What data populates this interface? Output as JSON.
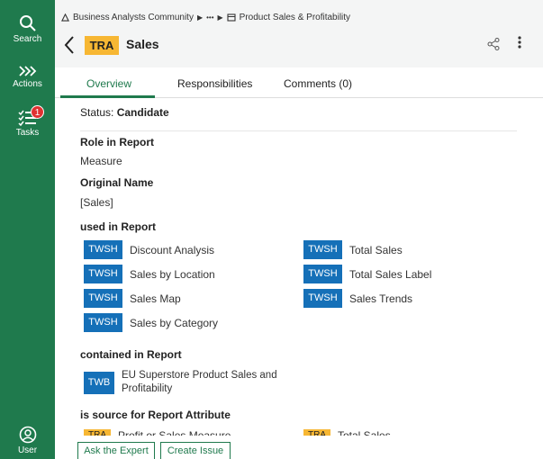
{
  "sidebar": {
    "items": [
      {
        "label": "Search",
        "icon": "search-icon"
      },
      {
        "label": "Actions",
        "icon": "chevrons-right-icon"
      },
      {
        "label": "Tasks",
        "icon": "task-list-icon",
        "badge": "1"
      },
      {
        "label": "User",
        "icon": "user-icon"
      }
    ]
  },
  "header": {
    "breadcrumb": {
      "root": "Business Analysts Community",
      "ellipsis": "•••",
      "current": "Product Sales & Profitability"
    },
    "tag": "TRA",
    "title": "Sales"
  },
  "tabs": [
    {
      "label": "Overview",
      "active": true
    },
    {
      "label": "Responsibilities",
      "active": false
    },
    {
      "label": "Comments (0)",
      "active": false
    }
  ],
  "overview": {
    "status_label": "Status:",
    "status_value": "Candidate",
    "role_title": "Role in Report",
    "role_value": "Measure",
    "original_title": "Original Name",
    "original_value": "[Sales]",
    "used_title": "used in Report",
    "used_reports": [
      {
        "type": "TWSH",
        "name": "Discount Analysis"
      },
      {
        "type": "TWSH",
        "name": "Total Sales"
      },
      {
        "type": "TWSH",
        "name": "Sales by Location"
      },
      {
        "type": "TWSH",
        "name": "Total Sales Label"
      },
      {
        "type": "TWSH",
        "name": "Sales Map"
      },
      {
        "type": "TWSH",
        "name": "Sales Trends"
      },
      {
        "type": "TWSH",
        "name": "Sales by Category"
      }
    ],
    "contained_title": "contained in Report",
    "contained_report": {
      "type": "TWB",
      "line1": "EU Superstore Product Sales and",
      "line2": "Profitability"
    },
    "source_title": "is source for Report Attribute",
    "source_attrs": [
      {
        "type": "TRA",
        "name": "Profit or Sales Measure"
      },
      {
        "type": "TRA",
        "name": "Total Sales"
      }
    ]
  },
  "footer": {
    "ask_label": "Ask the Expert",
    "issue_label": "Create Issue"
  },
  "colors": {
    "sidebar": "#1f7a4d",
    "accent": "#1f7a4d",
    "tra": "#f7b733",
    "twsh": "#1570b8"
  }
}
